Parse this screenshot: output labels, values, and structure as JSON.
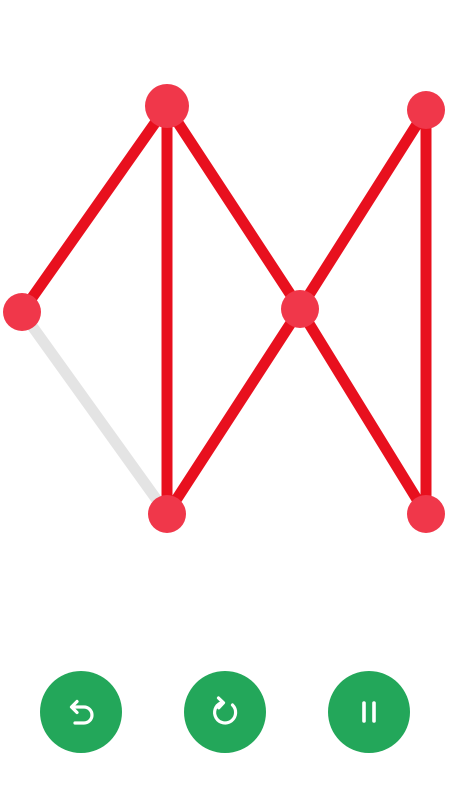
{
  "game": {
    "colors": {
      "background": "#ffffff",
      "drawn_line": "#e8101e",
      "undrawn_line": "#e4e4e4",
      "node": "#f0374a",
      "button": "#23a75a",
      "button_icon": "#ffffff"
    },
    "nodes": [
      {
        "id": "n-top-left",
        "active": true
      },
      {
        "id": "n-top-right",
        "active": false
      },
      {
        "id": "n-left",
        "active": false
      },
      {
        "id": "n-center",
        "active": false
      },
      {
        "id": "n-bottom-left",
        "active": false
      },
      {
        "id": "n-bottom-right",
        "active": false
      }
    ],
    "edges": [
      {
        "from": "n-left",
        "to": "n-top-left",
        "drawn": true
      },
      {
        "from": "n-top-left",
        "to": "n-bottom-left",
        "drawn": true
      },
      {
        "from": "n-top-left",
        "to": "n-center",
        "drawn": true
      },
      {
        "from": "n-center",
        "to": "n-bottom-right",
        "drawn": true
      },
      {
        "from": "n-center",
        "to": "n-top-right",
        "drawn": true
      },
      {
        "from": "n-top-right",
        "to": "n-bottom-right",
        "drawn": true
      },
      {
        "from": "n-center",
        "to": "n-bottom-left",
        "drawn": true
      },
      {
        "from": "n-left",
        "to": "n-bottom-left",
        "drawn": false
      }
    ]
  },
  "controls": {
    "buttons": [
      {
        "name": "undo-button",
        "icon": "undo-icon"
      },
      {
        "name": "restart-button",
        "icon": "restart-icon"
      },
      {
        "name": "pause-button",
        "icon": "pause-icon"
      }
    ]
  }
}
